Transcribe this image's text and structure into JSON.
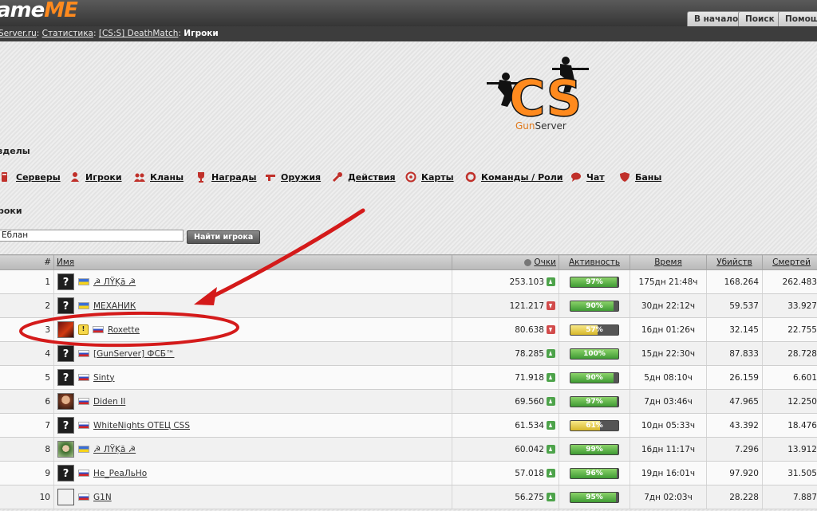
{
  "site": {
    "logo_main": "ame",
    "logo_accent": "ME",
    "top_nav": [
      "В начало",
      "Поиск",
      "Помощь"
    ]
  },
  "breadcrumb": {
    "items": [
      "Server.ru",
      "Статистика",
      "[CS:S] DeathMatch"
    ],
    "current": "Игроки"
  },
  "banner": {
    "logo_text": "CS",
    "subtitle_a": "Gun",
    "subtitle_b": "Server"
  },
  "sections_title": "зделы",
  "nav": [
    {
      "label": "Серверы",
      "icon": "server-icon"
    },
    {
      "label": "Игроки",
      "icon": "player-icon"
    },
    {
      "label": "Кланы",
      "icon": "clan-icon"
    },
    {
      "label": "Награды",
      "icon": "trophy-icon"
    },
    {
      "label": "Оружия",
      "icon": "weapon-icon"
    },
    {
      "label": "Действия",
      "icon": "wrench-icon"
    },
    {
      "label": "Карты",
      "icon": "target-icon"
    },
    {
      "label": "Команды / Роли",
      "icon": "roles-icon"
    },
    {
      "label": "Чат",
      "icon": "chat-icon"
    },
    {
      "label": "Баны",
      "icon": "shield-icon"
    }
  ],
  "players_title": "роки",
  "search": {
    "value": "Еблан",
    "button": "Найти игрока"
  },
  "table": {
    "headers": {
      "rank": "#",
      "name": "Имя",
      "points": "Очки",
      "activity": "Активность",
      "time": "Время",
      "kills": "Убийств",
      "deaths": "Смертей"
    },
    "rows": [
      {
        "rank": "1",
        "name": "☭ ЛŸĶā ☭",
        "flag": "ua",
        "avatar": "?",
        "points": "253.103",
        "trend": "up",
        "activity": "97%",
        "activity_value": 97,
        "activity_color": "g",
        "time": "175дн 21:48ч",
        "kills": "168.264",
        "deaths": "262.483"
      },
      {
        "rank": "2",
        "name": "МЕХАНИК",
        "flag": "ua",
        "avatar": "?",
        "points": "121.217",
        "trend": "down",
        "activity": "90%",
        "activity_value": 90,
        "activity_color": "g",
        "time": "30дн 22:12ч",
        "kills": "59.537",
        "deaths": "33.927"
      },
      {
        "rank": "3",
        "name": "Roxette",
        "flag": "ru",
        "avatar": "img1",
        "warn": true,
        "points": "80.638",
        "trend": "down",
        "activity": "57%",
        "activity_value": 57,
        "activity_color": "y",
        "time": "16дн 01:26ч",
        "kills": "32.145",
        "deaths": "22.755"
      },
      {
        "rank": "4",
        "name": "[GunServer] ФСБ™",
        "flag": "ru",
        "avatar": "?",
        "points": "78.285",
        "trend": "up",
        "activity": "100%",
        "activity_value": 100,
        "activity_color": "g",
        "time": "15дн 22:30ч",
        "kills": "87.833",
        "deaths": "28.728"
      },
      {
        "rank": "5",
        "name": "Sinty",
        "flag": "ru",
        "avatar": "?",
        "points": "71.918",
        "trend": "up",
        "activity": "90%",
        "activity_value": 90,
        "activity_color": "g",
        "time": "5дн 08:10ч",
        "kills": "26.159",
        "deaths": "6.601"
      },
      {
        "rank": "6",
        "name": "Diden II",
        "flag": "ru",
        "avatar": "img2",
        "points": "69.560",
        "trend": "up",
        "activity": "97%",
        "activity_value": 97,
        "activity_color": "g",
        "time": "7дн 03:46ч",
        "kills": "47.965",
        "deaths": "12.250"
      },
      {
        "rank": "7",
        "name": "WhiteNights ОТЕЦ CSS",
        "flag": "ru",
        "avatar": "?",
        "points": "61.534",
        "trend": "up",
        "activity": "61%",
        "activity_value": 61,
        "activity_color": "y",
        "time": "10дн 05:33ч",
        "kills": "43.392",
        "deaths": "18.476"
      },
      {
        "rank": "8",
        "name": "☭ ЛŸĶā ☭",
        "flag": "ua",
        "avatar": "img3",
        "points": "60.042",
        "trend": "up",
        "activity": "99%",
        "activity_value": 99,
        "activity_color": "g",
        "time": "16дн 11:17ч",
        "kills": "7.296",
        "deaths": "13.912"
      },
      {
        "rank": "9",
        "name": "Не_РеаЛьНо",
        "flag": "ru",
        "avatar": "?",
        "points": "57.018",
        "trend": "up",
        "activity": "96%",
        "activity_value": 96,
        "activity_color": "g",
        "time": "19дн 16:01ч",
        "kills": "97.920",
        "deaths": "31.505"
      },
      {
        "rank": "10",
        "name": "G1N",
        "flag": "ru",
        "avatar": "img4",
        "points": "56.275",
        "trend": "up",
        "activity": "95%",
        "activity_value": 95,
        "activity_color": "g",
        "time": "7дн 02:03ч",
        "kills": "28.228",
        "deaths": "7.887"
      }
    ]
  },
  "colors": {
    "annotation_red": "#d41a1a",
    "accent_orange": "#ff8a1e",
    "topbar": "#3d3d3d"
  }
}
